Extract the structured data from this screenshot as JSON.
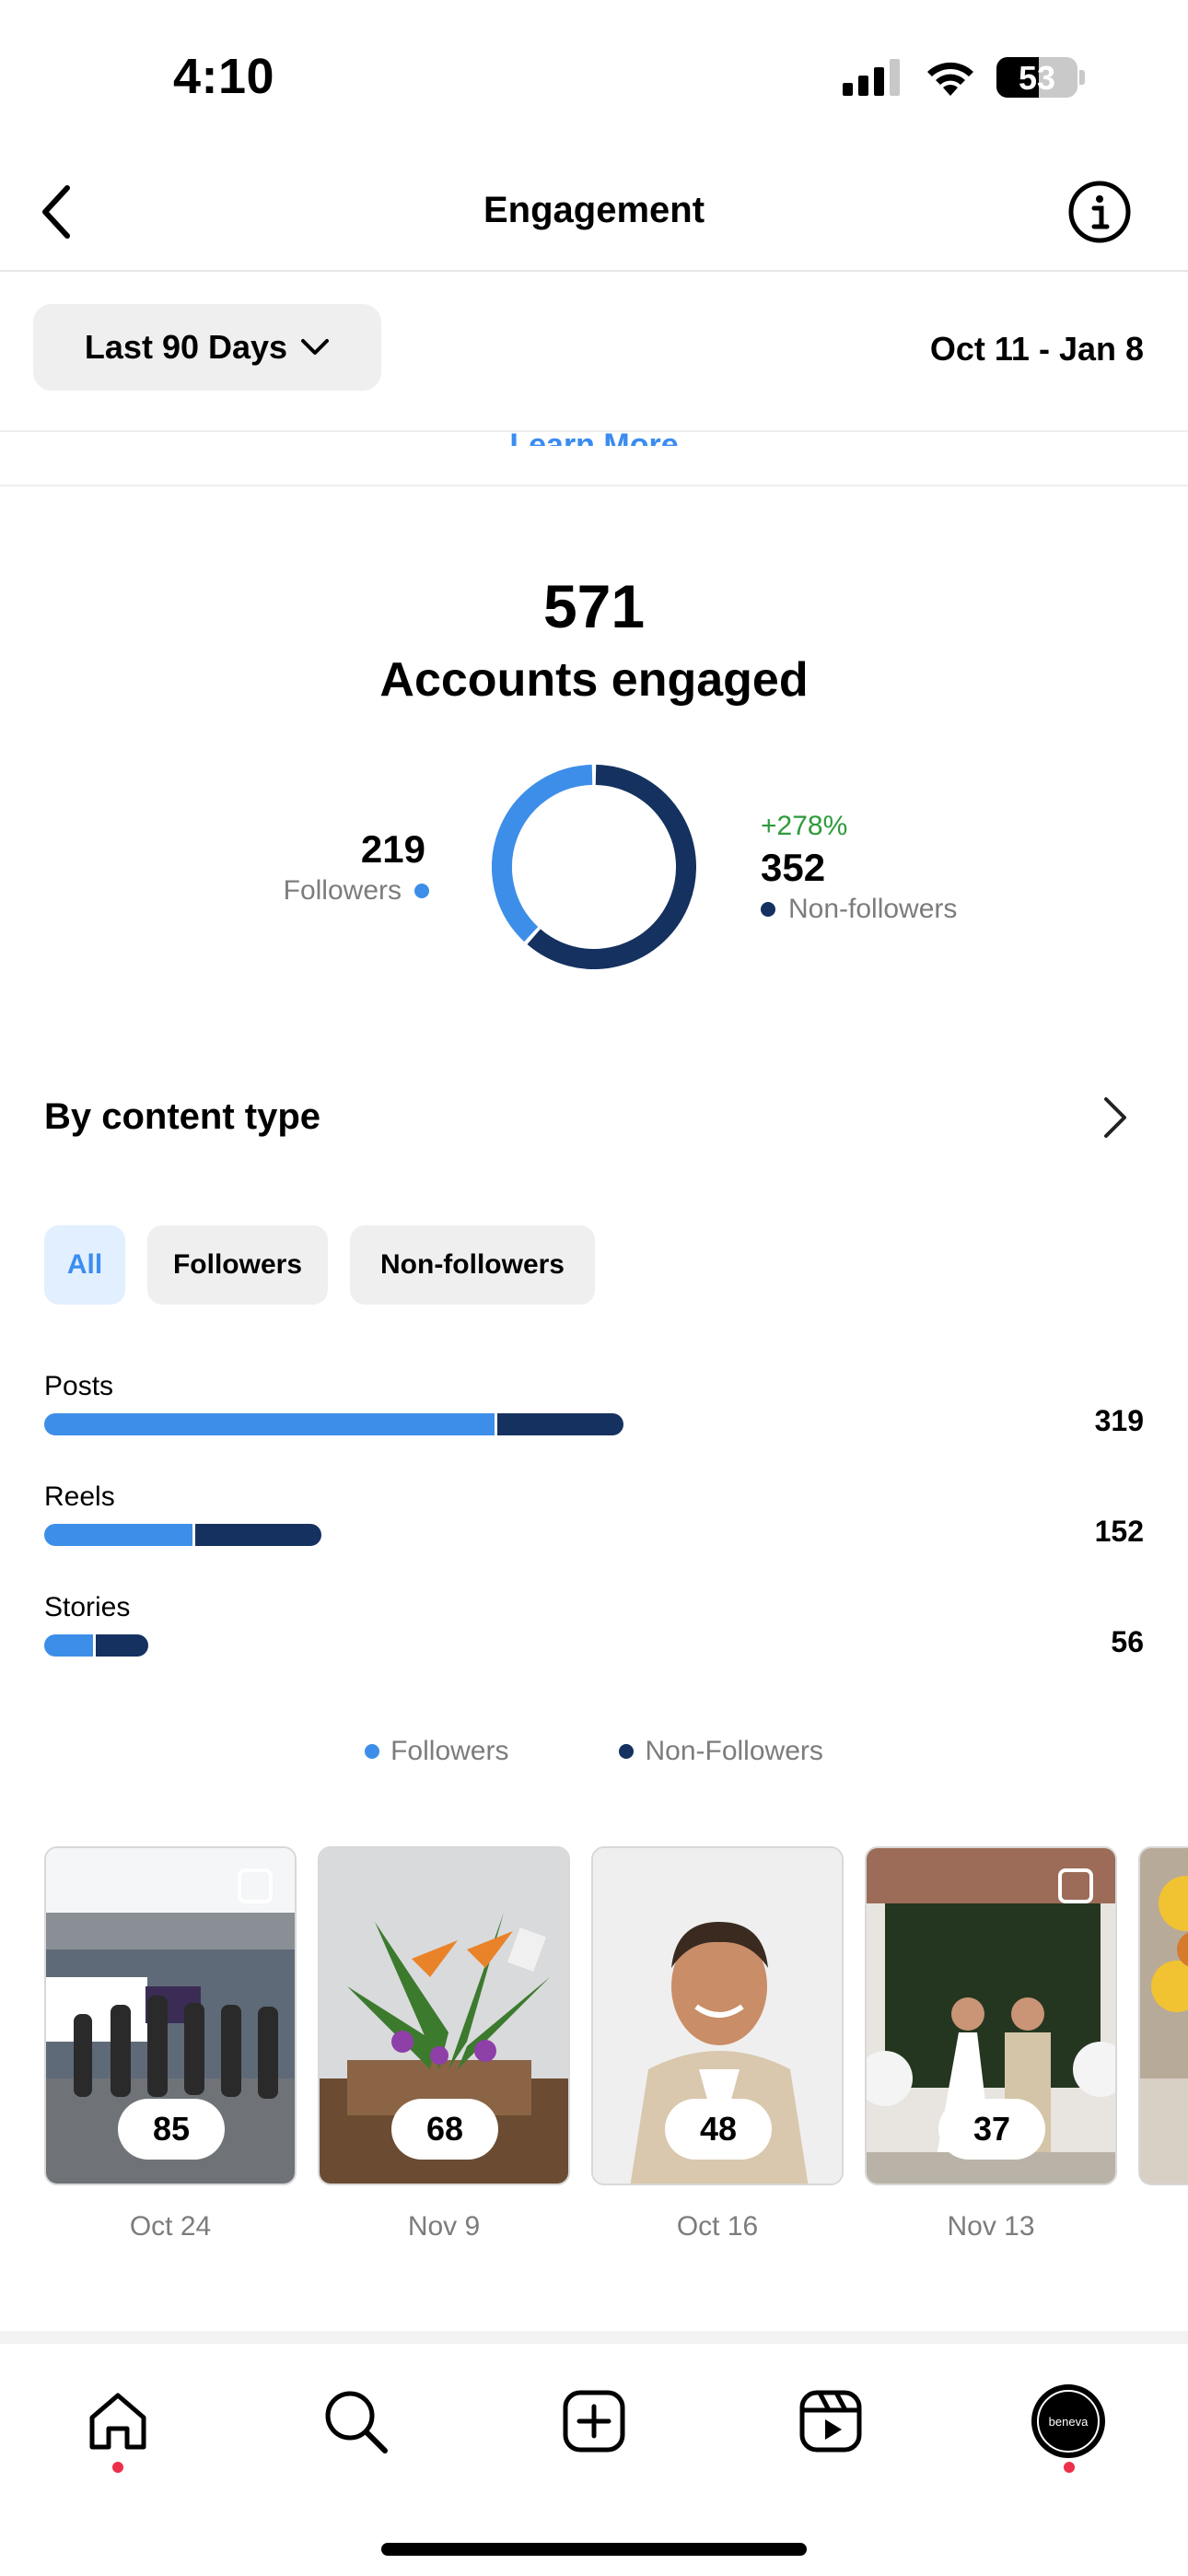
{
  "status_bar": {
    "time": "4:10",
    "battery": "53"
  },
  "header": {
    "title": "Engagement"
  },
  "filter": {
    "period": "Last 90 Days",
    "date_range": "Oct 11 - Jan 8",
    "learn_more": "Learn More"
  },
  "summary": {
    "count": "571",
    "label": "Accounts engaged",
    "followers": {
      "value": "219",
      "label": "Followers",
      "share": 0.3835
    },
    "non_followers": {
      "value": "352",
      "label": "Non-followers",
      "change": "+278%",
      "share": 0.6165
    },
    "colors": {
      "followers": "#3d8ee8",
      "non_followers": "#153160"
    }
  },
  "content_type": {
    "title": "By content type",
    "chips": [
      "All",
      "Followers",
      "Non-followers"
    ],
    "selected_chip": "All",
    "rows": [
      {
        "label": "Posts",
        "total": "319",
        "followers": 249,
        "non_followers": 70
      },
      {
        "label": "Reels",
        "total": "152",
        "followers": 82,
        "non_followers": 70
      },
      {
        "label": "Stories",
        "total": "56",
        "followers": 27,
        "non_followers": 29
      }
    ],
    "legend": [
      "Followers",
      "Non-Followers"
    ]
  },
  "top_content": [
    {
      "count": "85",
      "date": "Oct 24"
    },
    {
      "count": "68",
      "date": "Nov 9"
    },
    {
      "count": "48",
      "date": "Oct 16"
    },
    {
      "count": "37",
      "date": "Nov 13"
    }
  ],
  "tab_bar": {
    "tabs": [
      "home-icon",
      "search-icon",
      "create-icon",
      "reels-icon",
      "profile-avatar"
    ],
    "profile_avatar_text": "beneva"
  }
}
